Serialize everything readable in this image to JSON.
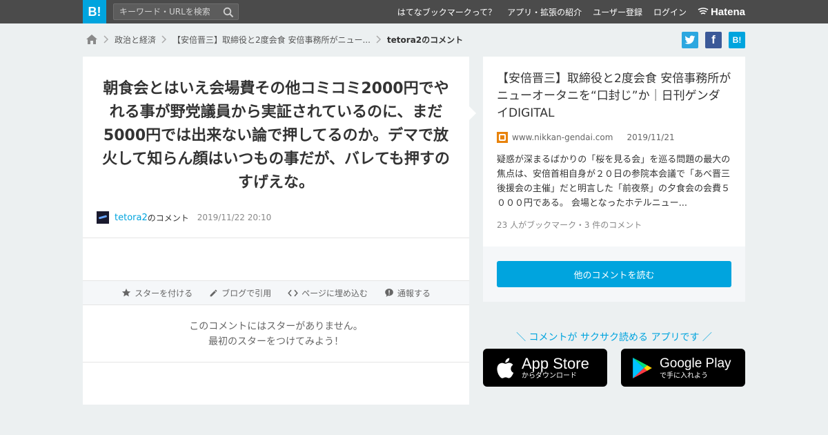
{
  "header": {
    "logo_text": "B!",
    "search_placeholder": "キーワード・URLを検索",
    "nav": [
      "はてなブックマークって？",
      "アプリ・拡張の紹介",
      "ユーザー登録",
      "ログイン"
    ],
    "hatena_logo": "Hatena"
  },
  "breadcrumb": {
    "items": [
      "政治と経済",
      "【安倍晋三】取締役と2度会食 安倍事務所がニュー...",
      "tetora2のコメント"
    ]
  },
  "share": {
    "twitter_icon": "twitter-icon",
    "facebook_label": "f",
    "hatena_label": "B!"
  },
  "comment": {
    "text": "朝食会とはいえ会場費その他コミコミ2000円でやれる事が野党議員から実証されているのに、まだ5000円では出来ない論で押してるのか。デマで放火して知らん顔はいつもの事だが、バレても押すのすげえな。",
    "user": "tetora2",
    "user_suffix": "のコメント",
    "date": "2019/11/22 20:10"
  },
  "actions": [
    "スターを付ける",
    "ブログで引用",
    "ページに埋め込む",
    "通報する"
  ],
  "no_star": {
    "line1": "このコメントにはスターがありません。",
    "line2": "最初のスターをつけてみよう！"
  },
  "entry": {
    "title": "【安倍晋三】取締役と2度会食 安倍事務所がニューオータニを“口封じ”か｜日刊ゲンダイDIGITAL",
    "domain": "www.nikkan-gendai.com",
    "date": "2019/11/21",
    "description": "疑惑が深まるばかりの「桜を見る会」を巡る問題の最大の焦点は、安倍首相自身が２０日の参院本会議で「あべ晋三後援会の主催」だと明言した「前夜祭」の夕食会の会費５０００円である。 会場となったホテルニュー...",
    "count": "23 人がブックマーク・3 件のコメント"
  },
  "read_more": "他のコメントを読む",
  "app_promo": "＼ コメントが サクサク読める アプリです ／",
  "app_store": {
    "title": "App Store",
    "sub": "からダウンロード"
  },
  "google_play": {
    "title": "Google Play",
    "sub": "で手に入れよう"
  },
  "colors": {
    "accent": "#00a4de",
    "topbar": "#4b4b4b",
    "background": "#ecf0f1",
    "twitter": "#1da1f2",
    "facebook": "#3b5998"
  }
}
